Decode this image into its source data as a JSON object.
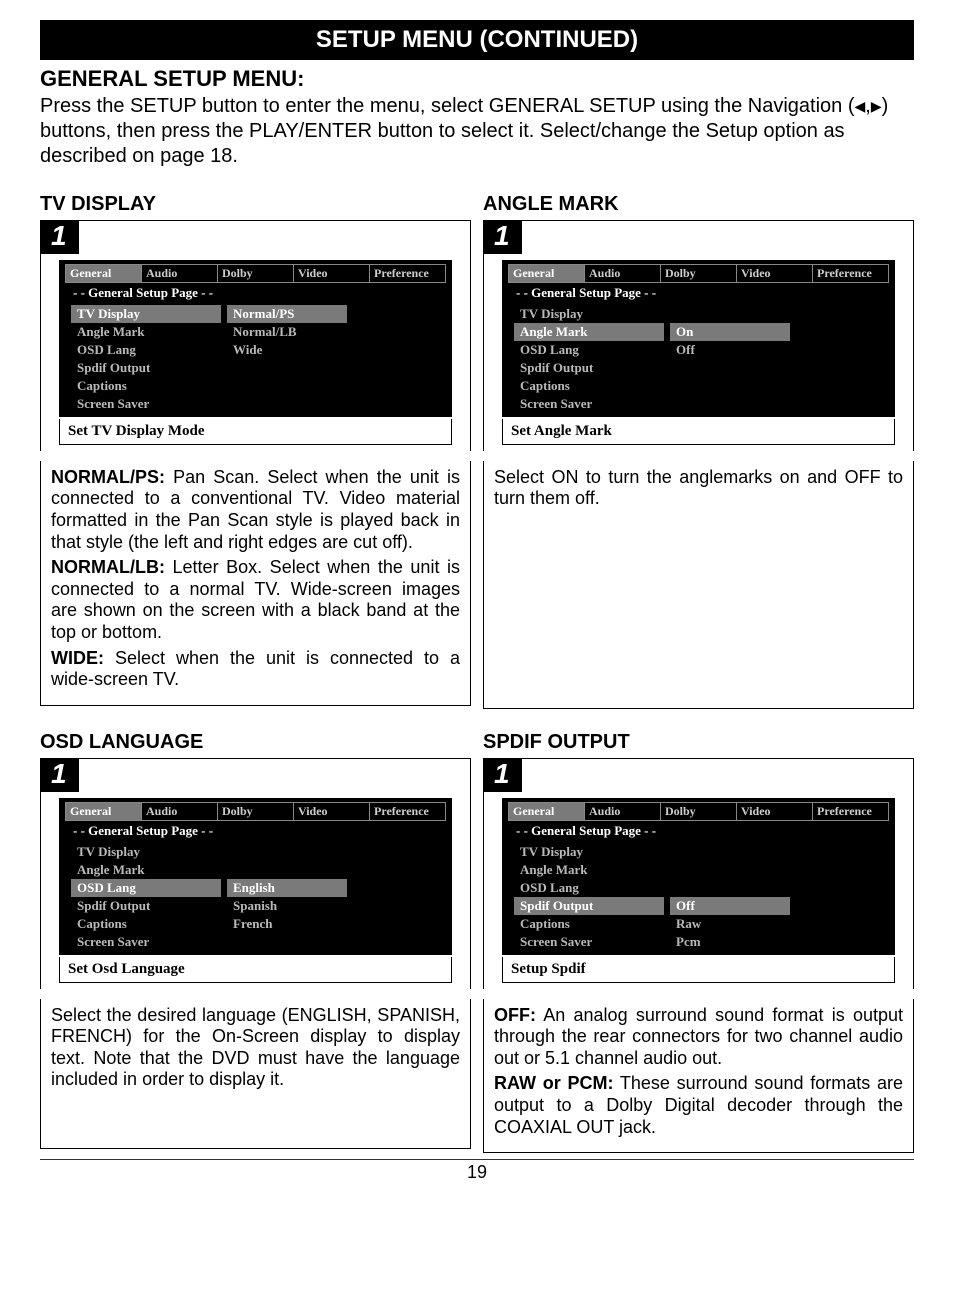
{
  "page_title": "SETUP MENU (CONTINUED)",
  "general_heading": "GENERAL SETUP MENU:",
  "intro_a": "Press the SETUP button to enter the menu, select GENERAL SETUP using the Navigation (",
  "intro_b": ") buttons, then press the PLAY/ENTER button to select it. Select/change the Setup option as described on page 18.",
  "arrow_left": "◀",
  "arrow_comma": ",",
  "arrow_right": "▶",
  "step_badge": "1",
  "osd_tabs": {
    "t0": "General",
    "t1": "Audio",
    "t2": "Dolby",
    "t3": "Video",
    "t4": "Preference"
  },
  "osd_subtitle": "- - General Setup Page - -",
  "osd_items": {
    "i0": "TV Display",
    "i1": "Angle Mark",
    "i2": "OSD Lang",
    "i3": "Spdif Output",
    "i4": "Captions",
    "i5": "Screen Saver"
  },
  "sections": {
    "tv_display": {
      "heading": "TV DISPLAY",
      "hint": "Set TV Display Mode",
      "opts": {
        "o0": "Normal/PS",
        "o1": "Normal/LB",
        "o2": "Wide"
      },
      "d1_lead": "NORMAL/PS:",
      "d1": " Pan Scan. Select when the unit is connected to a conventional TV. Video material formatted in the Pan Scan style is played back in that style (the left and right edges are cut off).",
      "d2_lead": "NORMAL/LB:",
      "d2": " Letter Box. Select when the unit is connected to a normal TV. Wide-screen images are shown on the screen with a black band at the top or bottom.",
      "d3_lead": "WIDE:",
      "d3": " Select when the unit is connected to a wide-screen TV."
    },
    "angle_mark": {
      "heading": "ANGLE MARK",
      "hint": "Set Angle Mark",
      "opts": {
        "o0": "On",
        "o1": "Off"
      },
      "d1": "Select ON to turn the anglemarks on and OFF to turn them off."
    },
    "osd_lang": {
      "heading": "OSD LANGUAGE",
      "hint": "Set Osd Language",
      "opts": {
        "o0": "English",
        "o1": "Spanish",
        "o2": "French"
      },
      "d1": "Select the desired language (ENGLISH, SPANISH, FRENCH) for the On-Screen display to display text. Note that the DVD must have the language included in order to display it."
    },
    "spdif": {
      "heading": "SPDIF OUTPUT",
      "hint": "Setup Spdif",
      "opts": {
        "o0": "Off",
        "o1": "Raw",
        "o2": "Pcm"
      },
      "d1_lead": "OFF:",
      "d1": " An analog surround sound format is output through the rear connectors for two channel audio out or 5.1 channel audio out.",
      "d2_lead": "RAW or PCM:",
      "d2": " These surround sound formats are output to a Dolby Digital decoder through the COAXIAL OUT jack."
    }
  },
  "page_number": "19"
}
